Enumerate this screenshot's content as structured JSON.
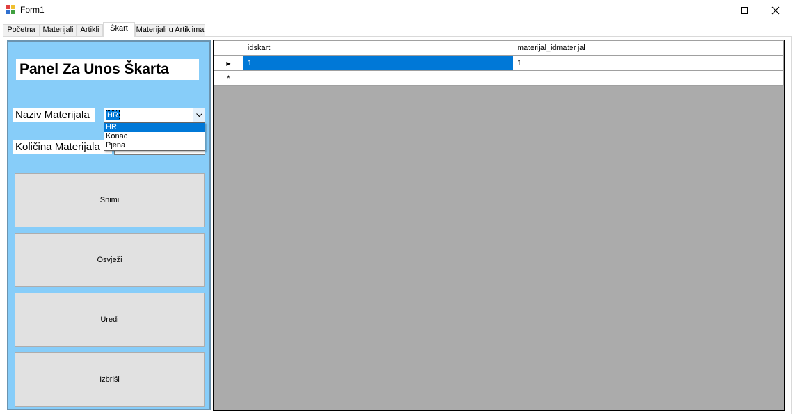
{
  "window": {
    "title": "Form1",
    "icon": "winforms-app-icon",
    "controls": [
      "minimize-icon",
      "maximize-icon",
      "close-icon"
    ]
  },
  "tabs": [
    {
      "label": "Početna"
    },
    {
      "label": "Materijali"
    },
    {
      "label": "Artikli"
    },
    {
      "label": "Škart",
      "active": true
    },
    {
      "label": "Materijali u Artiklima"
    }
  ],
  "panel": {
    "title": "Panel Za Unos Škarta",
    "background": "#87cdf9",
    "naziv_label": "Naziv Materijala",
    "kolicina_label": "Količina Materijala",
    "combo": {
      "value": "HR",
      "options": [
        "HR",
        "Konac",
        "Pjena"
      ],
      "selected_option": "HR"
    },
    "quantity_value": "",
    "buttons": {
      "save": "Snimi",
      "refresh": "Osvježi",
      "edit": "Uredi",
      "delete": "Izbriši"
    }
  },
  "grid": {
    "columns": [
      "idskart",
      "materijal_idmaterijal"
    ],
    "rows": [
      {
        "idskart": "1",
        "materijal_idmaterijal": "1"
      }
    ],
    "current_row_marker": "▶",
    "new_row_marker": "*",
    "selection_color": "#0078d7",
    "empty_area_color": "#ababab"
  }
}
